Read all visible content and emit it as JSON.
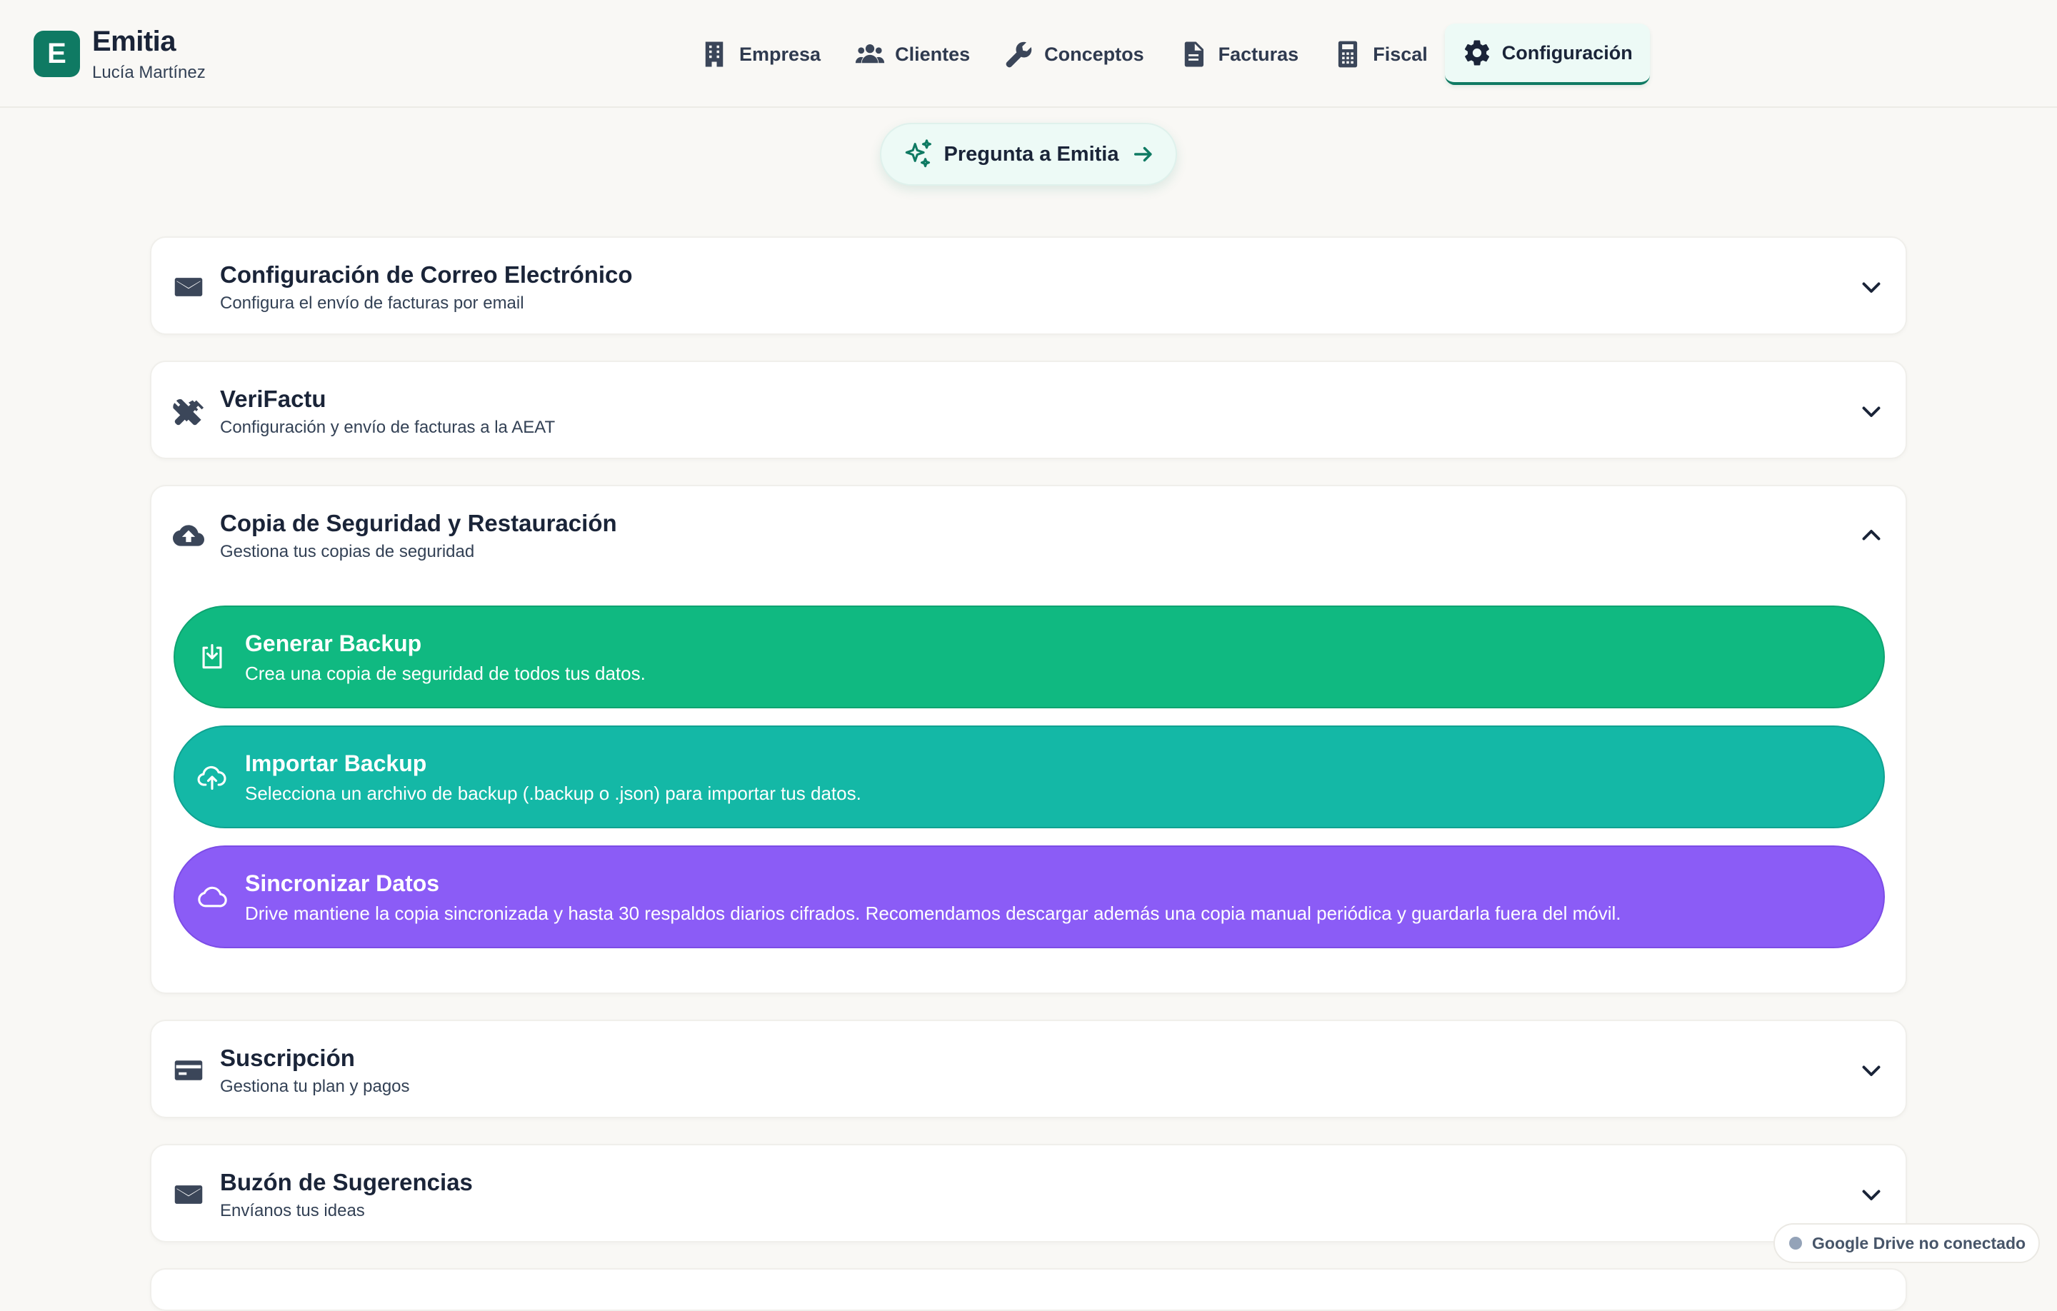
{
  "app": {
    "name": "Emitia",
    "user": "Lucía Martínez",
    "logo_letter": "E",
    "accent": "#0f7a63"
  },
  "nav": [
    {
      "label": "Empresa",
      "icon": "building-icon",
      "active": false
    },
    {
      "label": "Clientes",
      "icon": "users-icon",
      "active": false
    },
    {
      "label": "Conceptos",
      "icon": "wrench-icon",
      "active": false
    },
    {
      "label": "Facturas",
      "icon": "document-icon",
      "active": false
    },
    {
      "label": "Fiscal",
      "icon": "calculator-icon",
      "active": false
    },
    {
      "label": "Configuración",
      "icon": "gear-icon",
      "active": true
    }
  ],
  "ask": {
    "label": "Pregunta a Emitia"
  },
  "sections": [
    {
      "title": "Configuración de Correo Electrónico",
      "subtitle": "Configura el envío de facturas por email",
      "icon": "mail-icon",
      "expanded": false
    },
    {
      "title": "VeriFactu",
      "subtitle": "Configuración y envío de facturas a la AEAT",
      "icon": "tools-icon",
      "expanded": false
    },
    {
      "title": "Copia de Seguridad y Restauración",
      "subtitle": "Gestiona tus copias de seguridad",
      "icon": "cloud-upload-icon",
      "expanded": true
    },
    {
      "title": "Suscripción",
      "subtitle": "Gestiona tu plan y pagos",
      "icon": "credit-card-icon",
      "expanded": false
    },
    {
      "title": "Buzón de Sugerencias",
      "subtitle": "Envíanos tus ideas",
      "icon": "mail-icon",
      "expanded": false
    }
  ],
  "backup_actions": [
    {
      "title": "Generar Backup",
      "subtitle": "Crea una copia de seguridad de todos tus datos.",
      "icon": "download-icon",
      "color": "#10b981"
    },
    {
      "title": "Importar Backup",
      "subtitle": "Selecciona un archivo de backup (.backup o .json) para importar tus datos.",
      "icon": "cloud-upload-icon",
      "color": "#14b8a6"
    },
    {
      "title": "Sincronizar Datos",
      "subtitle": "Drive mantiene la copia sincronizada y hasta 30 respaldos diarios cifrados. Recomendamos descargar además una copia manual periódica y guardarla fuera del móvil.",
      "icon": "cloud-icon",
      "color": "#8b5cf6"
    }
  ],
  "drive_status": {
    "label": "Google Drive no conectado",
    "color": "#94a3b8"
  }
}
